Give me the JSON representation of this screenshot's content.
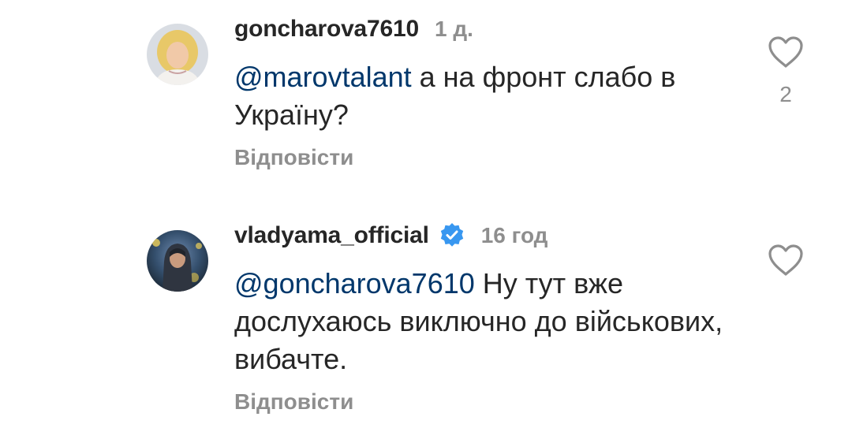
{
  "comments": [
    {
      "username": "goncharova7610",
      "time": "1 д.",
      "verified": false,
      "mention": "@marovtalant",
      "text": " а на фронт слабо в Україну?",
      "reply_label": "Відповісти",
      "likes": "2"
    },
    {
      "username": "vladyama_official",
      "time": "16 год",
      "verified": true,
      "mention": "@goncharova7610",
      "text": "  Ну тут вже дослухаюсь виключно до військових, вибачте.",
      "reply_label": "Відповісти"
    }
  ],
  "colors": {
    "text": "#262626",
    "secondary": "#8e8e8e",
    "mention": "#00376b",
    "verified_badge": "#3897f0"
  }
}
